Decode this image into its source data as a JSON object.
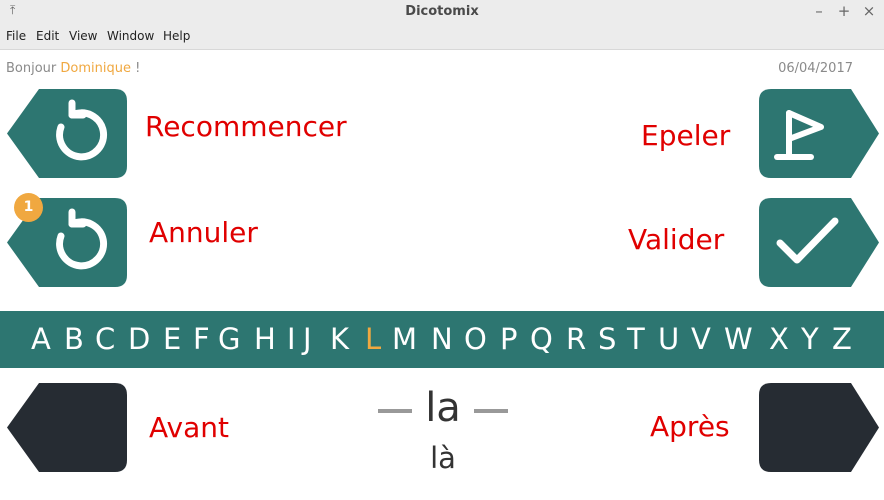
{
  "window": {
    "title": "Dicotomix"
  },
  "menu": [
    "File",
    "Edit",
    "View",
    "Window",
    "Help"
  ],
  "greeting": {
    "prefix": "Bonjour",
    "name": "Dominique",
    "suffix": "!"
  },
  "date": "06/04/2017",
  "buttons": {
    "recommencer": "Recommencer",
    "epeler": "Epeler",
    "annuler": "Annuler",
    "valider": "Valider",
    "avant": "Avant",
    "apres": "Après",
    "undo_count": "1"
  },
  "alphabet": {
    "letters": [
      "A",
      "B",
      "C",
      "D",
      "E",
      "F",
      "G",
      "H",
      "I",
      "J",
      "K",
      "L",
      "M",
      "N",
      "O",
      "P",
      "Q",
      "R",
      "S",
      "T",
      "U",
      "V",
      "W",
      "X",
      "Y",
      "Z"
    ],
    "active": "L"
  },
  "word": {
    "main": "la",
    "alt": "là"
  },
  "colors": {
    "teal": "#2d7671",
    "dark": "#262c33",
    "accent": "#f0a840",
    "label": "#e00000"
  },
  "icons": {
    "recommencer": "restart-arrow-icon",
    "annuler": "undo-arrow-icon",
    "epeler": "flag-icon",
    "valider": "checkmark-icon"
  }
}
